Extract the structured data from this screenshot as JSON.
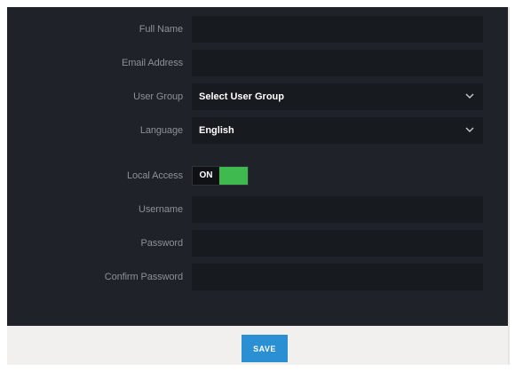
{
  "form": {
    "full_name": {
      "label": "Full Name",
      "value": ""
    },
    "email": {
      "label": "Email Address",
      "value": ""
    },
    "user_group": {
      "label": "User Group",
      "selected": "Select User Group"
    },
    "language": {
      "label": "Language",
      "selected": "English"
    },
    "local_access": {
      "label": "Local Access",
      "state": "ON",
      "enabled": true
    },
    "username": {
      "label": "Username",
      "value": ""
    },
    "password": {
      "label": "Password",
      "value": ""
    },
    "confirm_password": {
      "label": "Confirm Password",
      "value": ""
    }
  },
  "footer": {
    "save_label": "SAVE"
  },
  "colors": {
    "form_background": "#1f2329",
    "field_background": "#171a1e",
    "toggle_on": "#3fba4f",
    "save_button": "#2b8fd3",
    "footer_background": "#f1f0ee"
  },
  "icons": {
    "dropdown": "chevron-down-icon"
  }
}
